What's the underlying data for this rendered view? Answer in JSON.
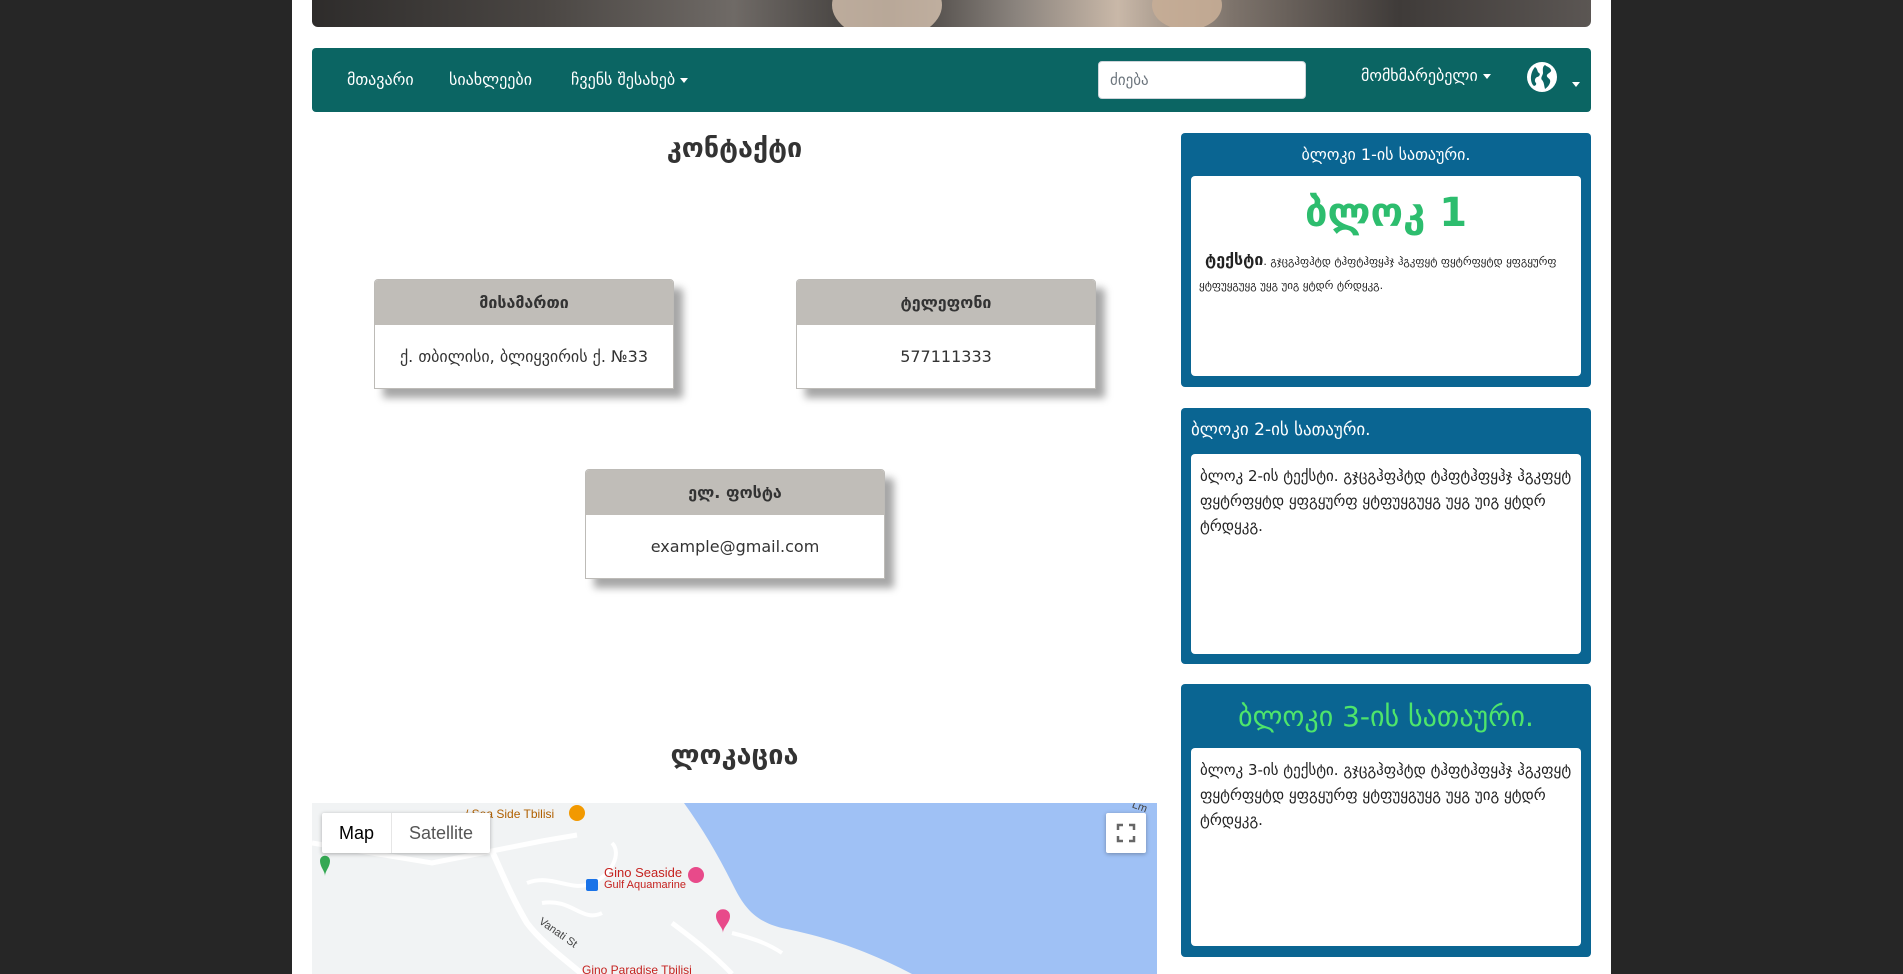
{
  "nav": {
    "home": "მთავარი",
    "news": "სიახლეები",
    "about": "ჩვენს შესახებ",
    "search_placeholder": "ძიება",
    "user": "მომხმარებელი"
  },
  "contact": {
    "title": "კონტაქტი",
    "address": {
      "label": "მისამართი",
      "value": "ქ. თბილისი, ბლიყვირის ქ. №33"
    },
    "phone": {
      "label": "ტელეფონი",
      "value": "577111333"
    },
    "email": {
      "label": "ელ. ფოსტა",
      "value": "example@gmail.com"
    }
  },
  "location": {
    "title": "ლოკაცია",
    "map_label": "Map",
    "satellite_label": "Satellite",
    "poi": {
      "sea_side": "/ Sea Side Tbilisi",
      "gino_seaside": "Gino Seaside",
      "gulf": "Gulf Aquamarine",
      "street": "Vanati St",
      "gino_paradise": "Gino Paradise Tbilisi",
      "edge_label": "Lm"
    }
  },
  "blocks": [
    {
      "title": "ბლოკი 1-ის სათაური.",
      "heading": "ბლოკ 1",
      "bold": "ტექსტი",
      "text": ". გჯცგჰფჰტდ ტჰფტჰფყჰჯ ჰგკფყტ ფყტრფყტდ ყფგყურფ ყტფუყგუყგ უყგ უიგ ყტდრ ტრდყკგ."
    },
    {
      "title": "ბლოკი 2-ის სათაური.",
      "text": "ბლოკ 2-ის ტექსტი. გჯცგჰფჰტდ ტჰფტჰფყჰჯ ჰგკფყტ ფყტრფყტდ ყფგყურფ ყტფუყგუყგ უყგ უიგ ყტდრ ტრდყკგ."
    },
    {
      "title": "ბლოკი 3-ის სათაური.",
      "text": "ბლოკ 3-ის ტექსტი. გჯცგჰფჰტდ ტჰფტჰფყჰჯ ჰგკფყტ ფყტრფყტდ ყფგყურფ ყტფუყგუყგ უყგ უიგ ყტდრ ტრდყკგ."
    }
  ],
  "colors": {
    "navbar": "#0b6563",
    "sidebar_block": "#0a6592",
    "block1_heading": "#2dbd6e",
    "block3_title": "#4ee56b",
    "map_water": "#9fc1f5",
    "card_header": "#c0bdb8"
  }
}
